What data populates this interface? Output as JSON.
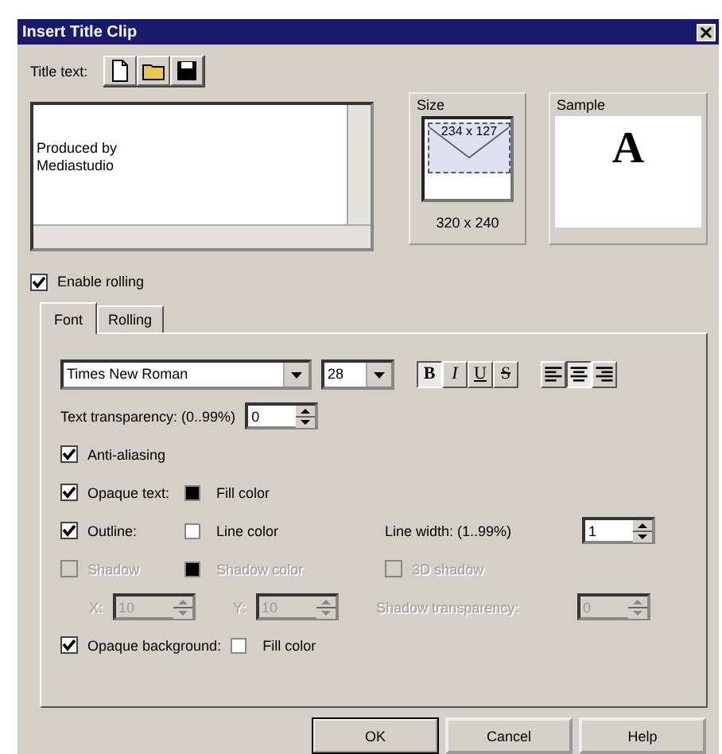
{
  "window": {
    "title": "Insert Title Clip"
  },
  "title_text": {
    "label": "Title text:",
    "value": "Produced by\nMediastudio"
  },
  "size": {
    "label": "Size",
    "selection": "234 x 127",
    "frame": "320 x 240"
  },
  "sample": {
    "label": "Sample",
    "glyph": "A"
  },
  "enable_rolling": {
    "label": "Enable rolling",
    "checked": true
  },
  "tabs": [
    {
      "label": "Font",
      "selected": true
    },
    {
      "label": "Rolling",
      "selected": false
    }
  ],
  "font": {
    "family": "Times New Roman",
    "size": "28"
  },
  "style_buttons": [
    {
      "label": "B",
      "pressed": true
    },
    {
      "label": "I",
      "pressed": false
    },
    {
      "label": "U",
      "pressed": false
    },
    {
      "label": "S",
      "pressed": false
    }
  ],
  "align_buttons": [
    {
      "kind": "left",
      "pressed": false
    },
    {
      "kind": "center",
      "pressed": true
    },
    {
      "kind": "right",
      "pressed": false
    }
  ],
  "transparency": {
    "label": "Text transparency: (0..99%)",
    "value": "0"
  },
  "anti_aliasing": {
    "label": "Anti-aliasing",
    "checked": true
  },
  "opaque_text": {
    "label": "Opaque text:",
    "checked": true,
    "color": "#000000",
    "color_label": "Fill color"
  },
  "outline": {
    "label": "Outline:",
    "checked": true,
    "color": "#ffffff",
    "color_label": "Line color",
    "width_label": "Line width: (1..99%)",
    "width_value": "1"
  },
  "shadow": {
    "label": "Shadow",
    "checked": false,
    "disabled": true,
    "color": "#000000",
    "color_label": "Shadow color"
  },
  "shadow_3d": {
    "label": "3D shadow",
    "checked": false,
    "disabled": true
  },
  "shadow_offset": {
    "disabled": true,
    "x_label": "X:",
    "x_value": "10",
    "y_label": "Y:",
    "y_value": "10",
    "transparency_label": "Shadow transparency:",
    "transparency_value": "0"
  },
  "opaque_background": {
    "label": "Opaque background:",
    "checked": true,
    "color": "#ffffff",
    "color_label": "Fill color"
  },
  "buttons": [
    {
      "label": "OK",
      "default": true
    },
    {
      "label": "Cancel",
      "default": false
    },
    {
      "label": "Help",
      "default": false
    }
  ]
}
